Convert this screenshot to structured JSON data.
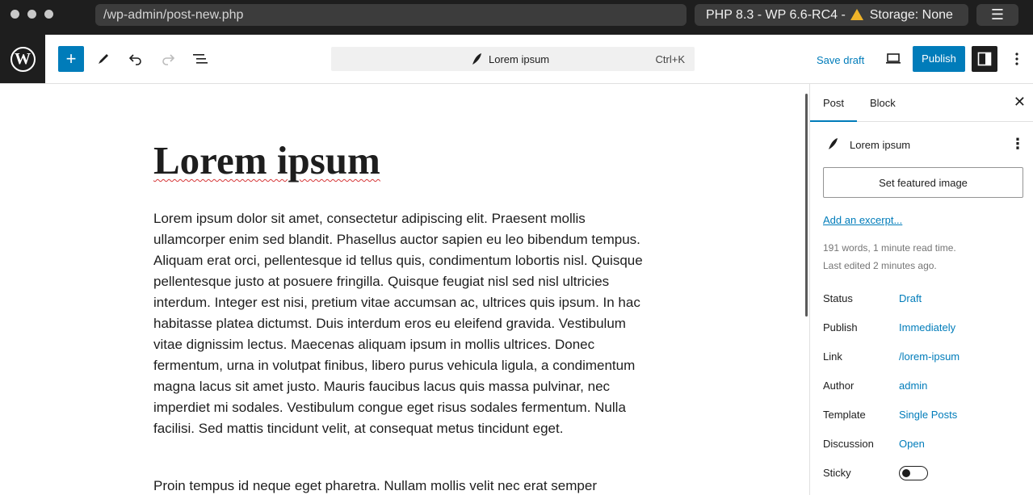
{
  "browser": {
    "url": "/wp-admin/post-new.php",
    "env_prefix": "PHP 8.3 - WP 6.6-RC4 -",
    "storage": "Storage: None",
    "menu_icon": "hamburger-icon"
  },
  "header": {
    "command_title": "Lorem ipsum",
    "shortcut": "Ctrl+K",
    "save_draft": "Save draft",
    "publish": "Publish",
    "accent_color": "#007cba"
  },
  "editor": {
    "title": "Lorem ipsum",
    "paragraph1": "Lorem ipsum dolor sit amet, consectetur adipiscing elit. Praesent mollis ullamcorper enim sed blandit. Phasellus auctor sapien eu leo bibendum tempus. Aliquam erat orci, pellentesque id tellus quis, condimentum lobortis nisl. Quisque pellentesque justo at posuere fringilla. Quisque feugiat nisl sed nisl ultricies interdum. Integer est nisi, pretium vitae accumsan ac, ultrices quis ipsum. In hac habitasse platea dictumst. Duis interdum eros eu eleifend gravida. Vestibulum vitae dignissim lectus. Maecenas aliquam ipsum in mollis ultrices. Donec fermentum, urna in volutpat finibus, libero purus vehicula ligula, a condimentum magna lacus sit amet justo. Mauris faucibus lacus quis massa pulvinar, nec imperdiet mi sodales. Vestibulum congue eget risus sodales fermentum. Nulla facilisi. Sed mattis tincidunt velit, at consequat metus tincidunt eget.",
    "paragraph2": "Proin tempus id neque eget pharetra. Nullam mollis velit nec erat semper"
  },
  "sidebar": {
    "tab_post": "Post",
    "tab_block": "Block",
    "post_name": "Lorem ipsum",
    "featured_image": "Set featured image",
    "excerpt_link": "Add an excerpt...",
    "word_count": "191 words, 1 minute read time.",
    "last_edited": "Last edited 2 minutes ago.",
    "rows": [
      {
        "label": "Status",
        "value": "Draft"
      },
      {
        "label": "Publish",
        "value": "Immediately"
      },
      {
        "label": "Link",
        "value": "/lorem-ipsum"
      },
      {
        "label": "Author",
        "value": "admin"
      },
      {
        "label": "Template",
        "value": "Single Posts"
      },
      {
        "label": "Discussion",
        "value": "Open"
      },
      {
        "label": "Sticky",
        "value": ""
      }
    ],
    "sticky_on": false
  }
}
